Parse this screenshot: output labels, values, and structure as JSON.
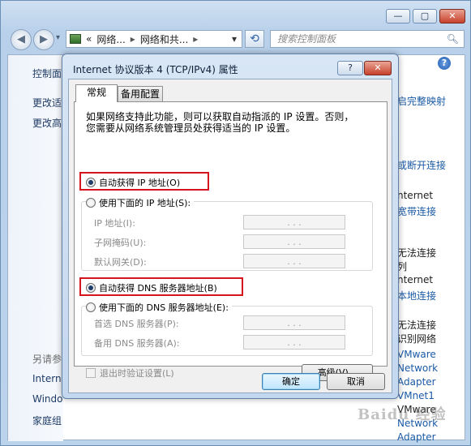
{
  "explorer": {
    "window_buttons": [
      "—",
      "▢",
      "✕"
    ],
    "nav_back": "◀",
    "nav_forward": "▶",
    "address_segments": [
      "«",
      "网络...",
      "▸",
      "网络和共...",
      "▸"
    ],
    "address_dropdown": "▾",
    "refresh_symbol": "⟲",
    "search_placeholder": "搜索控制面板",
    "search_icon": "search-icon",
    "help_symbol": "?",
    "left_pane": [
      {
        "text": "控制面",
        "kind": "title"
      },
      {
        "text": "更改适",
        "kind": "link"
      },
      {
        "text": "更改高",
        "kind": "link"
      },
      {
        "text": "另请参",
        "kind": "gray"
      },
      {
        "text": "Intern",
        "kind": "link"
      },
      {
        "text": "Windo",
        "kind": "link"
      },
      {
        "text": "家庭组",
        "kind": "link"
      }
    ],
    "right_pane": [
      {
        "text": "启完整映射",
        "kind": "link"
      },
      {
        "text": "或断开连接",
        "kind": "link"
      },
      {
        "text": "nternet",
        "kind": "txt"
      },
      {
        "text": "宽带连接",
        "kind": "link"
      },
      {
        "text": "无法连接",
        "kind": "txt"
      },
      {
        "text": "列",
        "kind": "txt"
      },
      {
        "text": "nternet",
        "kind": "txt"
      },
      {
        "text": "本地连接",
        "kind": "link"
      },
      {
        "text": "无法连接",
        "kind": "txt"
      },
      {
        "text": "识别网络",
        "kind": "txt"
      },
      {
        "text": "VMware",
        "kind": "link"
      },
      {
        "text": "Network",
        "kind": "link"
      },
      {
        "text": "Adapter",
        "kind": "link"
      },
      {
        "text": "VMnet1",
        "kind": "link"
      },
      {
        "text": "VMware",
        "kind": "txt"
      },
      {
        "text": "Network",
        "kind": "link"
      },
      {
        "text": "Adapter",
        "kind": "link"
      }
    ],
    "watermark": "Baidu 经验"
  },
  "dialog": {
    "title": "Internet 协议版本 4 (TCP/IPv4) 属性",
    "help_label": "?",
    "close_label": "✕",
    "tabs": [
      {
        "label": "常规",
        "active": true
      },
      {
        "label": "备用配置",
        "active": false
      }
    ],
    "intro_line1": "如果网络支持此功能，则可以获取自动指派的 IP 设置。否则，",
    "intro_line2": "您需要从网络系统管理员处获得适当的 IP 设置。",
    "ip_auto_label": "自动获得 IP 地址(O)",
    "ip_manual_label": "使用下面的 IP 地址(S):",
    "ip_auto_selected": true,
    "ip_fields": [
      {
        "label": "IP 地址(I):",
        "value": ". . ."
      },
      {
        "label": "子网掩码(U):",
        "value": ". . ."
      },
      {
        "label": "默认网关(D):",
        "value": ". . ."
      }
    ],
    "dns_auto_label": "自动获得 DNS 服务器地址(B)",
    "dns_manual_label": "使用下面的 DNS 服务器地址(E):",
    "dns_auto_selected": true,
    "dns_fields": [
      {
        "label": "首选 DNS 服务器(P):",
        "value": ". . ."
      },
      {
        "label": "备用 DNS 服务器(A):",
        "value": ". . ."
      }
    ],
    "validate_label": "退出时验证设置(L)",
    "validate_checked": false,
    "advanced_label": "高级(V)...",
    "ok_label": "确定",
    "cancel_label": "取消",
    "highlight_color": "#d4151b"
  }
}
